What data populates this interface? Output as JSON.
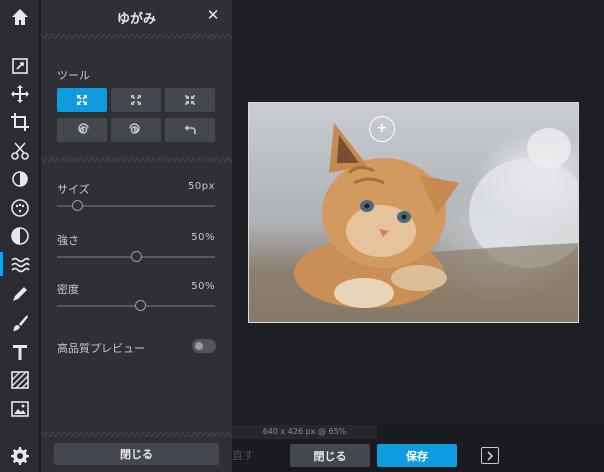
{
  "panel": {
    "title": "ゆがみ",
    "close_icon": "close-icon",
    "tools_label": "ツール",
    "tools": [
      {
        "name": "push-tool",
        "icon": "expand-arrows-icon",
        "selected": true
      },
      {
        "name": "bloat-tool",
        "icon": "bloat-arrows-icon",
        "selected": false
      },
      {
        "name": "pinch-tool",
        "icon": "pinch-arrows-icon",
        "selected": false
      },
      {
        "name": "twirl-left-tool",
        "icon": "swirl-left-icon",
        "selected": false
      },
      {
        "name": "twirl-right-tool",
        "icon": "swirl-right-icon",
        "selected": false
      },
      {
        "name": "restore-tool",
        "icon": "undo-arrow-icon",
        "selected": false
      }
    ],
    "size": {
      "label": "サイズ",
      "value_text": "50px",
      "fraction": 0.1
    },
    "strength": {
      "label": "強さ",
      "value_text": "50%",
      "fraction": 0.5
    },
    "density": {
      "label": "密度",
      "value_text": "50%",
      "fraction": 0.53
    },
    "hq_preview": {
      "label": "高品質プレビュー",
      "on": false
    },
    "close_button": "閉じる"
  },
  "bottom": {
    "image_info": "640 x 426 px @ 65%",
    "redo_label": "直す",
    "close_button": "閉じる",
    "save_button": "保存"
  },
  "colors": {
    "accent": "#0f9be0",
    "panel_bg": "#2e3035",
    "iconbar_bg": "#2a2c31"
  }
}
